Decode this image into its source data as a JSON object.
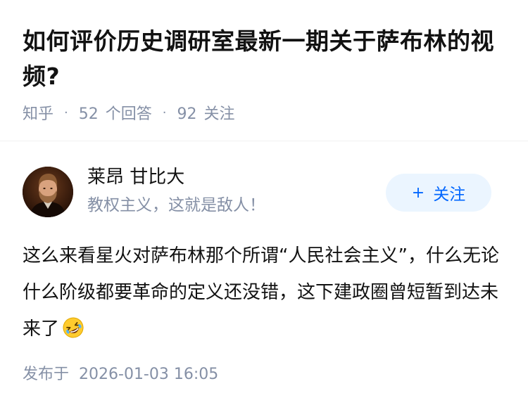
{
  "question": {
    "title": "如何评价历史调研室最新一期关于萨布林的视频?",
    "source": "知乎",
    "answer_count": "52",
    "answer_label": "个回答",
    "follower_count": "92",
    "follower_label": "关注",
    "separator": "·"
  },
  "author": {
    "name": "莱昂 甘比大",
    "bio": "教权主义，这就是敌人！",
    "avatar_icon": "portrait-avatar"
  },
  "follow_button": {
    "plus": "+",
    "label": "关注"
  },
  "answer": {
    "content": "这么来看星火对萨布林那个所谓“人民社会主义”，什么无论什么阶级都要革命的定义还没错，这下建政圈曾短暂到达未来了",
    "emoji_icon": "rofl-emoji-icon",
    "published_label": "发布于",
    "published_time": "2026-01-03 16:05"
  },
  "colors": {
    "title": "#121212",
    "meta": "#8590a6",
    "accent": "#0066ff",
    "follow_bg": "#ebf5ff",
    "emoji_face": "#ffcb2e"
  }
}
